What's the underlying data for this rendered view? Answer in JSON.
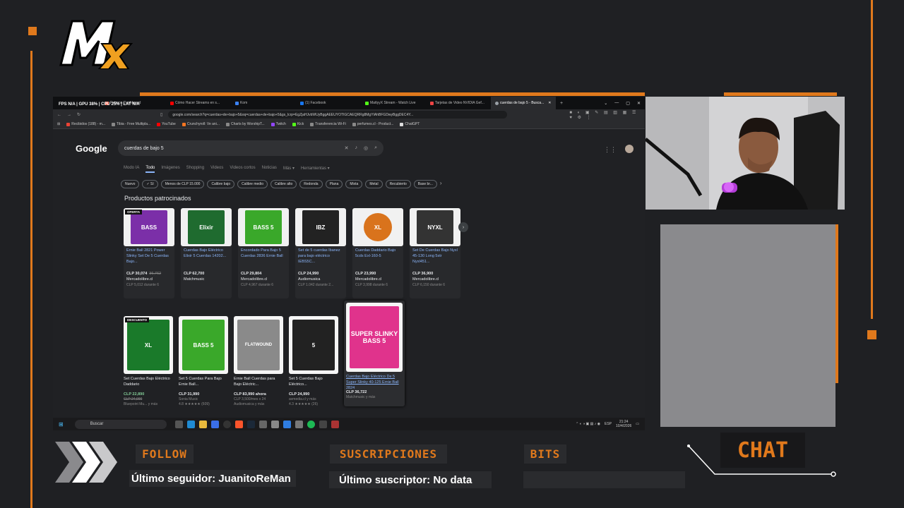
{
  "brand": {
    "logo_text": "MX",
    "accent": "#e0791c"
  },
  "browser": {
    "perf_overlay": "FPS N/A | GPU 38% | CPU 25% | LAT N/A",
    "tabs": [
      {
        "label": "Patreon Dashboard",
        "color": "#f96854"
      },
      {
        "label": "Cómo Hacer Streams en s...",
        "color": "#ff0000"
      },
      {
        "label": "Kom",
        "color": "#3b82f6"
      },
      {
        "label": "(1) Facebook",
        "color": "#1877f2"
      },
      {
        "label": "MattyyX Stream - Watch Live",
        "color": "#53fc18"
      },
      {
        "label": "Tarjetas de Video NVIDIA Gef...",
        "color": "#e44"
      },
      {
        "label": "cuerdas de bajo 5 - Busca...",
        "color": "#9aa0a6",
        "active": true
      }
    ],
    "url": "google.com/search?q=cuerdas+de+bajo+5&oq=cuerdas+de+bajo+5&gs_lcrp=EgZjaHJvbWUyBggAEEUYOTIGCAEQRRg8MgYIAhBFGDwyBggDEC4Y...",
    "bookmarks": [
      "Recibidos (188) - m...",
      "Tibia - Free Multipla...",
      "YouTube",
      "Crunchyroll: Ve ani...",
      "Charts by WorshipT...",
      "Twitch",
      "Kick",
      "Transferencia Wi-Fi",
      "perfumes.cl - Product...",
      "ChatGPT"
    ]
  },
  "google": {
    "logo": "Google",
    "query": "cuerdas de bajo 5",
    "nav_tabs": [
      "Modo IA",
      "Todo",
      "Imágenes",
      "Shopping",
      "Videos",
      "Videos cortos",
      "Noticias",
      "Más ▾",
      "Herramientas ▾"
    ],
    "chips": [
      "Nuevo",
      "✓ Sí",
      "Menos de CLP 15.000",
      "Calibre bajo",
      "Calibre medio",
      "Calibre alto",
      "Redonda",
      "Plana",
      "Mixta",
      "Metal",
      "Recubierto",
      "Base br..."
    ],
    "sponsored_title": "Productos patrocinados",
    "products": [
      {
        "badge": "OFERTA",
        "title": "Ernie Ball 2821 Power Slinky Set De 5 Cuerdas Bajo...",
        "price": "CLP 30,074",
        "old_price": "36,762",
        "store": "Mercadolibre.cl",
        "installments": "CLP 5,012 durante 6",
        "pack_color": "#7b2fa8",
        "pack_text": "BASS"
      },
      {
        "badge": "",
        "title": "Cuerdas Bajo Eléctrico Elixir 5 Cuerdas 14202...",
        "price": "CLP 62,700",
        "old_price": "",
        "store": "Matchmusic",
        "installments": "",
        "pack_color": "#1f6b2f",
        "pack_text": "Elixir"
      },
      {
        "badge": "",
        "title": "Encordado Para Bajo 5 Cuerdas 2836 Ernie Ball",
        "price": "CLP 29,804",
        "old_price": "",
        "store": "Mercadolibre.cl",
        "installments": "CLP 4,967 durante 6",
        "pack_color": "#3aa82a",
        "pack_text": "BASS 5"
      },
      {
        "badge": "",
        "title": "Set de 5 cuerdas Ibanez para bajo eléctrico IEBS5C...",
        "price": "CLP 24,990",
        "old_price": "",
        "store": "Audiomusica",
        "installments": "CLP 1.042 durante 2...",
        "pack_color": "#222",
        "pack_text": "IBZ"
      },
      {
        "badge": "",
        "title": "Cuerdas Daddario Bajo 5cds Exl-160-5",
        "price": "CLP 23,990",
        "old_price": "",
        "store": "Mercadolibre.cl",
        "installments": "CLP 3,998 durante 6",
        "pack_color": "#d9731c",
        "pack_text": "XL"
      },
      {
        "badge": "",
        "title": "Set De Cuerdas Bajo Nyxl 45-130 Long 5str Nyxl451...",
        "price": "CLP 36,900",
        "old_price": "",
        "store": "Mercadolibre.cl",
        "installments": "CLP 6,150 durante 6",
        "pack_color": "#333",
        "pack_text": "NYXL"
      }
    ],
    "grid": [
      {
        "badge": "DESCUENTO",
        "title": "Set Cuerdas Bajo Eléctrico Daddario",
        "price": "CLP 22,890",
        "sub": "CLP 24,990",
        "sub2": "Bluepoint Mu... y más",
        "pack_color": "#1a7a2a",
        "pack_text": "XL"
      },
      {
        "badge": "",
        "title": "Set 5 Cuerdas Para Bajo Ernie Ball...",
        "price": "CLP 31,990",
        "sub": "Sonia Music",
        "sub2": "4.8 ★★★★★ (609)",
        "pack_color": "#3aa82a",
        "pack_text": "BASS 5"
      },
      {
        "badge": "",
        "title": "Ernie Ball Cuerdas para Bajo Eléctric...",
        "price": "CLP 83,990 ahora",
        "sub": "CLP 3,500/mes x 24",
        "sub2": "Audiomusica y más",
        "pack_color": "#8a8a8a",
        "pack_text": "FLATWOUND"
      },
      {
        "badge": "",
        "title": "Set 5 Cuerdas Bajo Eléctrico...",
        "price": "CLP 24,990",
        "sub": "avmedia.cl y más",
        "sub2": "4.3 ★★★★★ (26)",
        "pack_color": "#222",
        "pack_text": "5"
      },
      {
        "badge": "",
        "title": "Cuerdas Bajo Eléctrico De 5 Super Slinky 40-125 Ernie Ball 2824",
        "price": "CLP 36,722",
        "sub": "Matchmusic y más",
        "sub2": "",
        "pack_color": "#e0338c",
        "pack_text": "SUPER SLINKY BASS 5",
        "hover": true
      }
    ]
  },
  "taskbar": {
    "search_placeholder": "Buscar",
    "lang": "ESP",
    "time": "21:24",
    "date": "10/4/2026"
  },
  "bottom": {
    "follow_label": "FOLLOW",
    "follow_value": "Último seguidor: JuanitoReMan",
    "subs_label": "SUSCRIPCIONES",
    "subs_value": "Último suscriptor: No data",
    "bits_label": "BITS",
    "bits_value": "",
    "chat_label": "CHAT"
  }
}
